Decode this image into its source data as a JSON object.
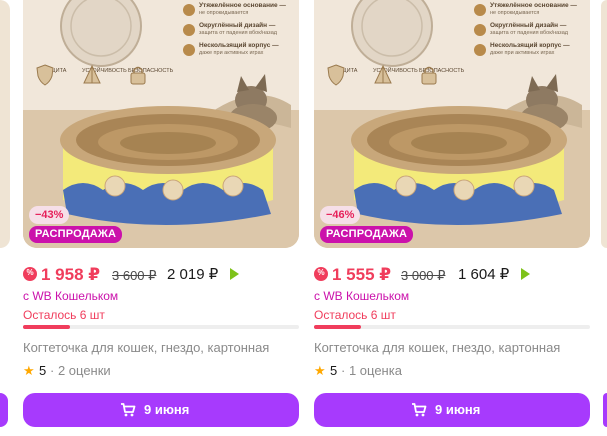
{
  "products": [
    {
      "features": [
        {
          "title": "Утяжелённое основание —",
          "sub": "не опрокидывается"
        },
        {
          "title": "Округлённый дизайн —",
          "sub": "защита от падения вбок/назад"
        },
        {
          "title": "Нескользящий корпус —",
          "sub": "даже при активных играх"
        }
      ],
      "badges": [
        {
          "label": "ЗАЩИТА",
          "icon": "shield-icon"
        },
        {
          "label": "УСТОЙЧИВОСТЬ",
          "icon": "pyramid-icon"
        },
        {
          "label": "БЕЗОПАСНОСТЬ",
          "icon": "lock-icon"
        }
      ],
      "discount": "−43%",
      "sale_label": "РАСПРОДАЖА",
      "price": "1 958 ₽",
      "old_price": "3 600 ₽",
      "wallet_price": "2 019 ₽",
      "wallet_label": "с WB Кошельком",
      "stock": "Осталось 6 шт",
      "stock_level": 0.17,
      "title": "Когтеточка для кошек, гнездо, картонная",
      "rating": "5",
      "reviews": "· 2 оценки",
      "button_label": "9 июня"
    },
    {
      "features": [
        {
          "title": "Утяжелённое основание —",
          "sub": "не опрокидывается"
        },
        {
          "title": "Округлённый дизайн —",
          "sub": "защита от падения вбок/назад"
        },
        {
          "title": "Нескользящий корпус —",
          "sub": "даже при активных играх"
        }
      ],
      "badges": [
        {
          "label": "ЗАЩИТА",
          "icon": "shield-icon"
        },
        {
          "label": "УСТОЙЧИВОСТЬ",
          "icon": "pyramid-icon"
        },
        {
          "label": "БЕЗОПАСНОСТЬ",
          "icon": "lock-icon"
        }
      ],
      "discount": "−46%",
      "sale_label": "РАСПРОДАЖА",
      "price": "1 555 ₽",
      "old_price": "3 000 ₽",
      "wallet_price": "1 604 ₽",
      "wallet_label": "с WB Кошельком",
      "stock": "Осталось 6 шт",
      "stock_level": 0.17,
      "title": "Когтеточка для кошек, гнездо, картонная",
      "rating": "5",
      "reviews": "· 1 оценка",
      "button_label": "9 июня"
    }
  ],
  "colors": {
    "accent": "#a73afd",
    "sale": "#cb11ab",
    "price": "#f03d5c",
    "star": "#ffa800"
  }
}
